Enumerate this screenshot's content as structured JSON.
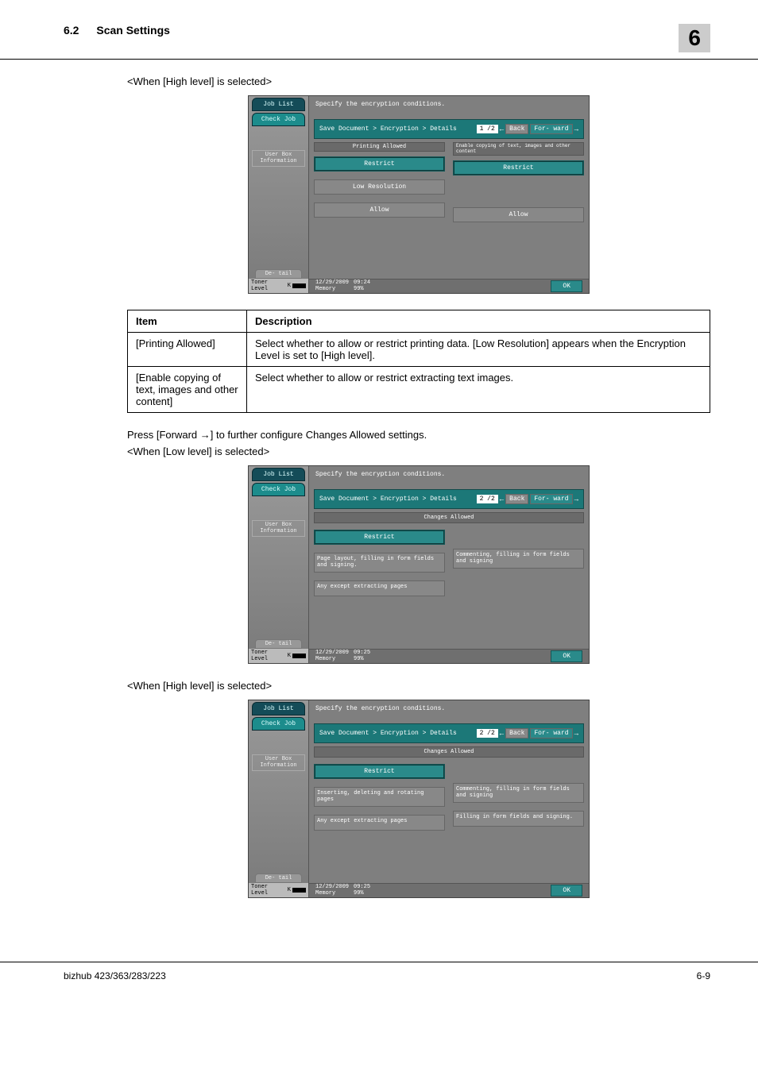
{
  "header": {
    "section_num": "6.2",
    "section_title": "Scan Settings",
    "chapter_badge": "6"
  },
  "captions": {
    "high1": "<When [High level] is selected>",
    "low": "<When [Low level] is selected>",
    "high2": "<When [High level] is selected>",
    "press_forward": "Press [Forward →] to further configure Changes Allowed settings."
  },
  "screen_common": {
    "job_list": "Job List",
    "check_job": "Check Job",
    "user_box": "User Box Information",
    "detail": "De- tail",
    "toner": "Toner Level",
    "toner_k": "K",
    "specify": "Specify the encryption conditions.",
    "breadcrumb": "Save Document > Encryption > Details",
    "back": "Back",
    "forward": "For- ward",
    "ok": "OK",
    "date": "12/29/2009",
    "memory": "Memory",
    "mem_val": "99%"
  },
  "screen1": {
    "page": "1 /2",
    "time": "09:24",
    "col1_header": "Printing Allowed",
    "col2_header": "Enable copying of text, images and other content",
    "col1": {
      "restrict": "Restrict",
      "lowres": "Low Resolution",
      "allow": "Allow"
    },
    "col2": {
      "restrict": "Restrict",
      "allow": "Allow"
    }
  },
  "table1": {
    "h1": "Item",
    "h2": "Description",
    "r1c1": "[Printing Allowed]",
    "r1c2": "Select whether to allow or restrict printing data. [Low Resolution] appears when the Encryption Level is set to [High level].",
    "r2c1": "[Enable copying of text, images and other content]",
    "r2c2": "Select whether to allow or restrict extracting text images."
  },
  "screen2": {
    "page": "2 /2",
    "time": "09:25",
    "section_header": "Changes Allowed",
    "opts": {
      "restrict": "Restrict",
      "page_layout": "Page layout, filling in form fields and signing.",
      "commenting": "Commenting, filling in form fields and signing",
      "any_except": "Any except extracting pages"
    }
  },
  "screen3": {
    "page": "2 /2",
    "time": "09:25",
    "section_header": "Changes Allowed",
    "opts": {
      "restrict": "Restrict",
      "inserting": "Inserting, deleting and rotating pages",
      "commenting": "Commenting, filling in form fields and signing",
      "any_except": "Any except extracting pages",
      "filling": "Filling in form fields and signing."
    }
  },
  "footer": {
    "left": "bizhub 423/363/283/223",
    "right": "6-9"
  }
}
